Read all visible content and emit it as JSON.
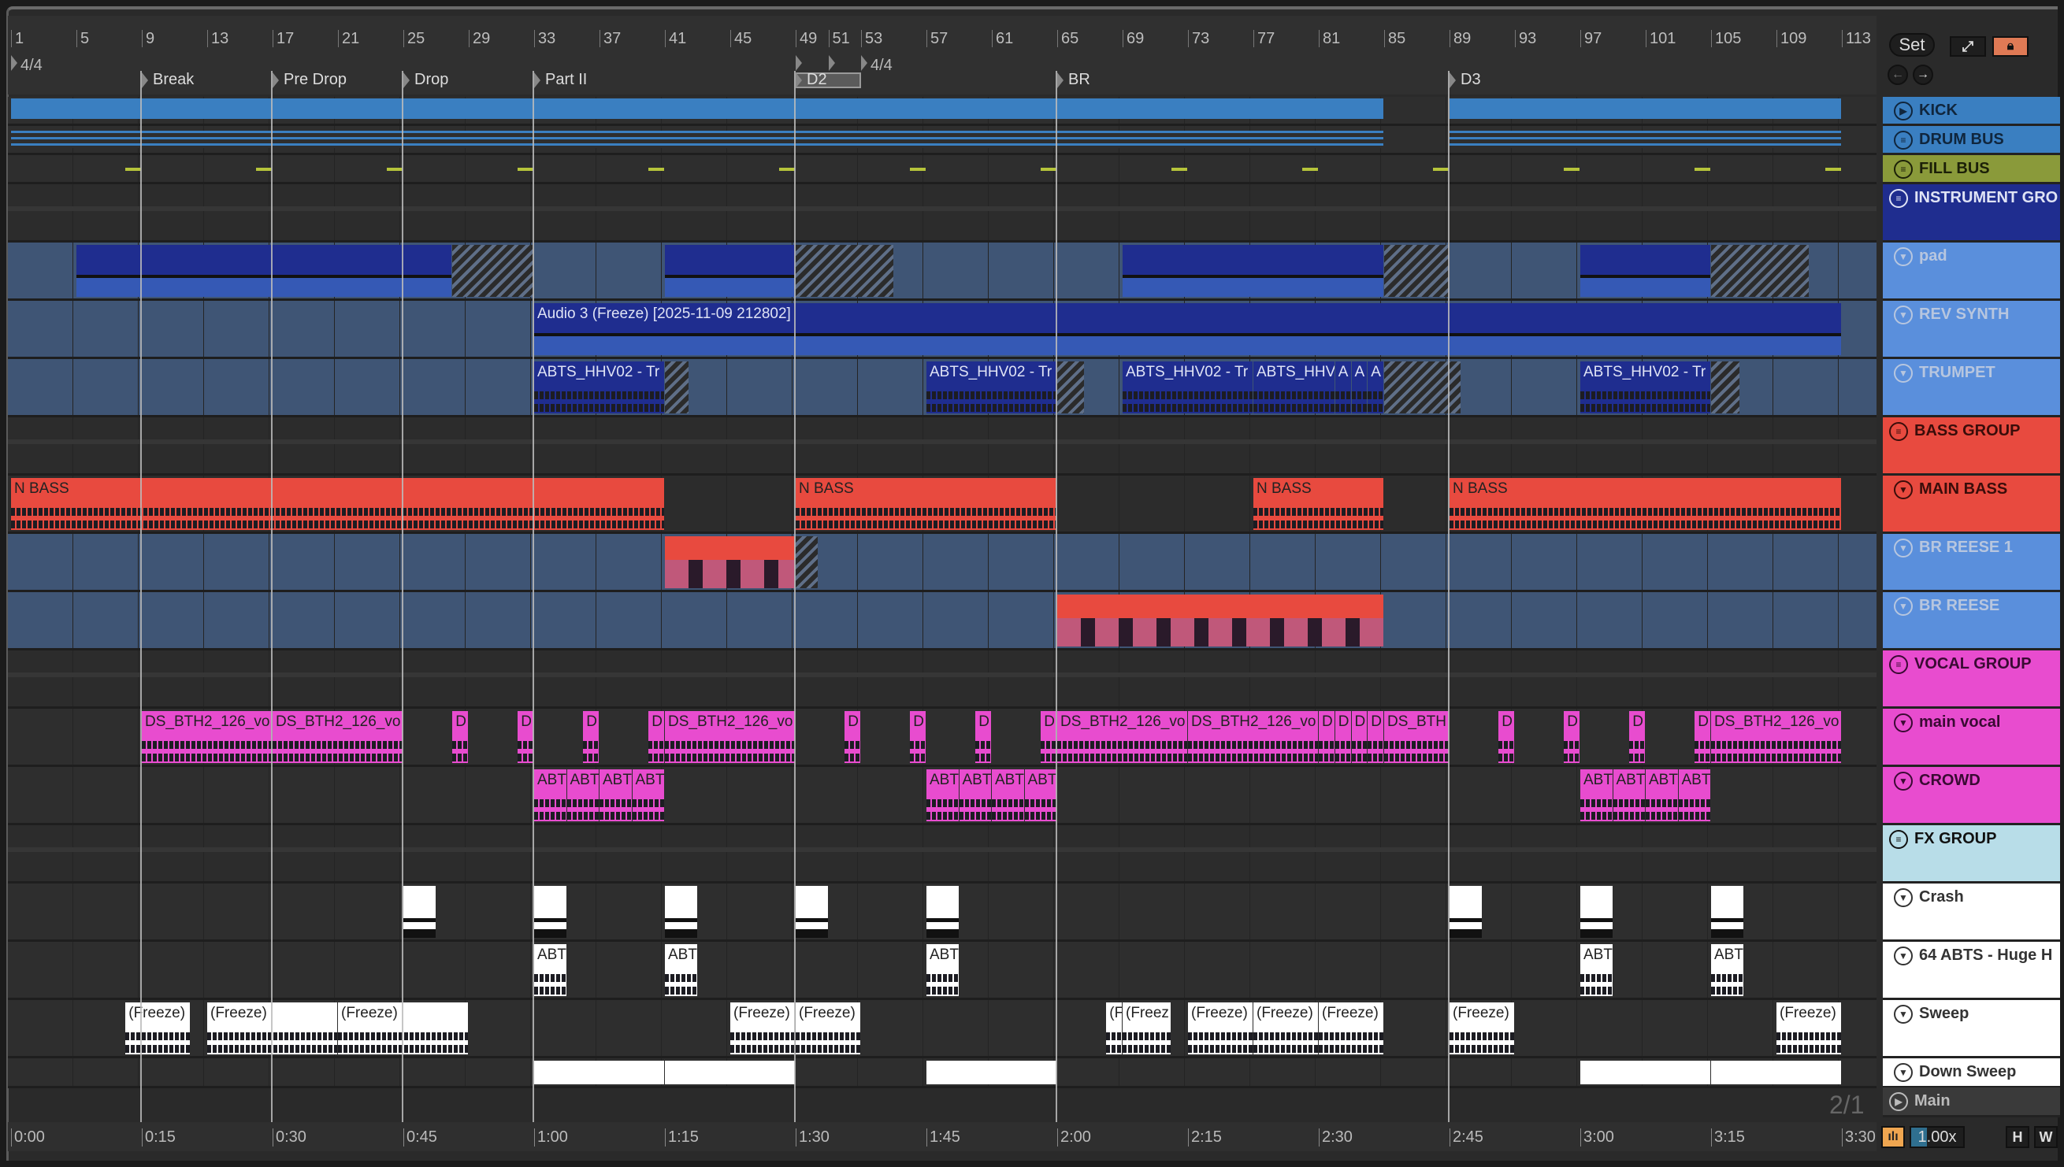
{
  "ruler": {
    "bars": [
      "1",
      "5",
      "9",
      "13",
      "17",
      "21",
      "25",
      "29",
      "33",
      "37",
      "41",
      "45",
      "49",
      "51",
      "53",
      "57",
      "61",
      "65",
      "69",
      "73",
      "77",
      "81",
      "85",
      "89",
      "93",
      "97",
      "101",
      "105",
      "109",
      "113"
    ],
    "bar_positions": [
      1,
      5,
      9,
      13,
      17,
      21,
      25,
      29,
      33,
      37,
      41,
      45,
      49,
      51,
      53,
      57,
      61,
      65,
      69,
      73,
      77,
      81,
      85,
      89,
      93,
      97,
      101,
      105,
      109,
      113
    ],
    "time_signatures": [
      {
        "bar": 1,
        "label": "4/4"
      },
      {
        "bar": 53,
        "label": "4/4"
      }
    ],
    "loop": {
      "start": 49,
      "end": 53
    },
    "locators": [
      {
        "bar": 9,
        "label": "Break"
      },
      {
        "bar": 17,
        "label": "Pre Drop"
      },
      {
        "bar": 25,
        "label": "Drop"
      },
      {
        "bar": 33,
        "label": "Part II"
      },
      {
        "bar": 49,
        "label": "D2"
      },
      {
        "bar": 65,
        "label": "BR"
      },
      {
        "bar": 89,
        "label": "D3"
      }
    ]
  },
  "time_ruler": [
    "0:00",
    "0:15",
    "0:30",
    "0:45",
    "1:00",
    "1:15",
    "1:30",
    "1:45",
    "2:00",
    "2:15",
    "2:30",
    "2:45",
    "3:00",
    "3:15",
    "3:30"
  ],
  "controls": {
    "set": "Set",
    "zoom": "1.00x",
    "h": "H",
    "w": "W",
    "grid": "2/1"
  },
  "colors": {
    "blue": "#3a7fc1",
    "olive": "#8a9a3a",
    "navy": "#1f2d8f",
    "lightblue": "#5a8fdc",
    "red": "#e84a3f",
    "pink": "#e84ccf",
    "cyan": "#b8dde8",
    "white": "#ffffff"
  },
  "tracks": [
    {
      "name": "KICK",
      "icon": "play",
      "color": "#3a7fc1",
      "text": "#10263d",
      "bg": "#2e2e2e",
      "clipColor": "#3a7fc1",
      "clips": [
        {
          "s": 1,
          "e": 85
        },
        {
          "s": 89,
          "e": 113
        }
      ]
    },
    {
      "name": "DRUM BUS",
      "icon": "group",
      "color": "#3a7fc1",
      "text": "#10263d",
      "bg": "#2e2e2e",
      "clipColor": "#3a7fc1",
      "thin": true,
      "clips": [
        {
          "s": 1,
          "e": 85
        },
        {
          "s": 89,
          "e": 113
        }
      ]
    },
    {
      "name": "FILL BUS",
      "icon": "group",
      "color": "#8a9a3a",
      "text": "#1c2008",
      "bg": "#2e2e2e",
      "clipColor": "#b6c43a",
      "dash": true,
      "clips": [
        {
          "s": 8,
          "e": 9
        },
        {
          "s": 16,
          "e": 17
        },
        {
          "s": 24,
          "e": 25
        },
        {
          "s": 32,
          "e": 33
        },
        {
          "s": 40,
          "e": 41
        },
        {
          "s": 48,
          "e": 49
        },
        {
          "s": 56,
          "e": 57
        },
        {
          "s": 64,
          "e": 65
        },
        {
          "s": 72,
          "e": 73
        },
        {
          "s": 80,
          "e": 81
        },
        {
          "s": 88,
          "e": 89
        },
        {
          "s": 96,
          "e": 97
        },
        {
          "s": 104,
          "e": 105
        },
        {
          "s": 112,
          "e": 113
        }
      ]
    },
    {
      "name": "INSTRUMENT GRO",
      "icon": "group",
      "color": "#1f2d8f",
      "text": "#dfe3f5",
      "bg": "#2c2c2c",
      "group": true,
      "clips": []
    },
    {
      "name": "pad",
      "icon": "fold",
      "color": "#5a8fdc",
      "text": "#b7c6df",
      "bg": "#3f5575",
      "clipColor": "#1f2d8f",
      "clips": [
        {
          "s": 5,
          "e": 28
        },
        {
          "s": 28,
          "e": 33,
          "hatch": true
        },
        {
          "s": 41,
          "e": 49
        },
        {
          "s": 49,
          "e": 55,
          "hatch": true
        },
        {
          "s": 69,
          "e": 85
        },
        {
          "s": 85,
          "e": 89,
          "hatch": true
        },
        {
          "s": 97,
          "e": 105
        },
        {
          "s": 105,
          "e": 111,
          "hatch": true
        }
      ]
    },
    {
      "name": "REV SYNTH",
      "icon": "fold",
      "color": "#5a8fdc",
      "text": "#b7c6df",
      "bg": "#3f5575",
      "clipColor": "#1f2d8f",
      "clips": [
        {
          "s": 33,
          "e": 113,
          "label": "Audio 3 (Freeze) [2025-11-09 212802]"
        }
      ]
    },
    {
      "name": "TRUMPET",
      "icon": "fold",
      "color": "#5a8fdc",
      "text": "#b7c6df",
      "bg": "#3f5575",
      "clipColor": "#1f2d8f",
      "wave": true,
      "clips": [
        {
          "s": 33,
          "e": 41,
          "label": "ABTS_HHV02 - Tr"
        },
        {
          "s": 41,
          "e": 42.5,
          "hatch": true
        },
        {
          "s": 57,
          "e": 65,
          "label": "ABTS_HHV02 - Tr"
        },
        {
          "s": 65,
          "e": 66.7,
          "hatch": true
        },
        {
          "s": 69,
          "e": 77,
          "label": "ABTS_HHV02 - Tr"
        },
        {
          "s": 77,
          "e": 82,
          "label": "ABTS_HHV"
        },
        {
          "s": 82,
          "e": 83,
          "label": "A"
        },
        {
          "s": 83,
          "e": 84,
          "label": "A"
        },
        {
          "s": 84,
          "e": 85,
          "label": "A"
        },
        {
          "s": 85,
          "e": 89.7,
          "hatch": true
        },
        {
          "s": 97,
          "e": 105,
          "label": "ABTS_HHV02 - Tr"
        },
        {
          "s": 105,
          "e": 106.8,
          "hatch": true
        }
      ]
    },
    {
      "name": "BASS GROUP",
      "icon": "group",
      "color": "#e84a3f",
      "text": "#3a0d0a",
      "bg": "#2c2c2c",
      "group": true,
      "clips": []
    },
    {
      "name": "MAIN BASS",
      "icon": "fold",
      "color": "#e84a3f",
      "text": "#3a0d0a",
      "bg": "#2c2c2c",
      "clipColor": "#e84a3f",
      "clips": [
        {
          "s": 1,
          "e": 41,
          "label": "N BASS"
        },
        {
          "s": 49,
          "e": 65,
          "label": "N BASS"
        },
        {
          "s": 77,
          "e": 85,
          "label": "N BASS"
        },
        {
          "s": 89,
          "e": 113,
          "label": "N BASS"
        }
      ]
    },
    {
      "name": "BR REESE 1",
      "icon": "fold",
      "color": "#5a8fdc",
      "text": "#b7c6df",
      "bg": "#3f5575",
      "clipColor": "#e84a3f",
      "clips": [
        {
          "s": 41,
          "e": 49
        },
        {
          "s": 49,
          "e": 50.4,
          "hatch": true
        }
      ]
    },
    {
      "name": "BR REESE",
      "icon": "fold",
      "color": "#5a8fdc",
      "text": "#b7c6df",
      "bg": "#3f5575",
      "clipColor": "#e84a3f",
      "clips": [
        {
          "s": 65,
          "e": 85
        }
      ]
    },
    {
      "name": "VOCAL GROUP",
      "icon": "group",
      "color": "#e84ccf",
      "text": "#3a0a33",
      "bg": "#2c2c2c",
      "group": true,
      "clips": []
    },
    {
      "name": "main vocal",
      "icon": "fold",
      "color": "#e84ccf",
      "text": "#3a0a33",
      "bg": "#2e2e2e",
      "clipColor": "#e84ccf",
      "wave": true,
      "clips": [
        {
          "s": 9,
          "e": 17,
          "label": "DS_BTH2_126_vo"
        },
        {
          "s": 17,
          "e": 25,
          "label": "DS_BTH2_126_vo"
        },
        {
          "s": 28,
          "e": 29,
          "label": "D"
        },
        {
          "s": 32,
          "e": 33,
          "label": "D"
        },
        {
          "s": 36,
          "e": 37,
          "label": "D"
        },
        {
          "s": 40,
          "e": 41,
          "label": "D"
        },
        {
          "s": 41,
          "e": 49,
          "label": "DS_BTH2_126_vo"
        },
        {
          "s": 52,
          "e": 53,
          "label": "D"
        },
        {
          "s": 56,
          "e": 57,
          "label": "D"
        },
        {
          "s": 60,
          "e": 61,
          "label": "D"
        },
        {
          "s": 64,
          "e": 65,
          "label": "D"
        },
        {
          "s": 65,
          "e": 73,
          "label": "DS_BTH2_126_vo"
        },
        {
          "s": 73,
          "e": 81,
          "label": "DS_BTH2_126_vo"
        },
        {
          "s": 81,
          "e": 82,
          "label": "D"
        },
        {
          "s": 82,
          "e": 83,
          "label": "D"
        },
        {
          "s": 83,
          "e": 84,
          "label": "D"
        },
        {
          "s": 84,
          "e": 85,
          "label": "D"
        },
        {
          "s": 85,
          "e": 89,
          "label": "DS_BTH"
        },
        {
          "s": 92,
          "e": 93,
          "label": "D"
        },
        {
          "s": 96,
          "e": 97,
          "label": "D"
        },
        {
          "s": 100,
          "e": 101,
          "label": "D"
        },
        {
          "s": 104,
          "e": 105,
          "label": "D"
        },
        {
          "s": 105,
          "e": 113,
          "label": "DS_BTH2_126_vo"
        }
      ]
    },
    {
      "name": "CROWD",
      "icon": "fold",
      "color": "#e84ccf",
      "text": "#3a0a33",
      "bg": "#2e2e2e",
      "clipColor": "#e84ccf",
      "wave": true,
      "clips": [
        {
          "s": 33,
          "e": 35,
          "label": "ABT"
        },
        {
          "s": 35,
          "e": 37,
          "label": "ABT"
        },
        {
          "s": 37,
          "e": 39,
          "label": "ABT"
        },
        {
          "s": 39,
          "e": 41,
          "label": "ABT"
        },
        {
          "s": 57,
          "e": 59,
          "label": "ABT"
        },
        {
          "s": 59,
          "e": 61,
          "label": "ABT"
        },
        {
          "s": 61,
          "e": 63,
          "label": "ABT"
        },
        {
          "s": 63,
          "e": 65,
          "label": "ABT"
        },
        {
          "s": 97,
          "e": 99,
          "label": "ABT"
        },
        {
          "s": 99,
          "e": 101,
          "label": "ABT"
        },
        {
          "s": 101,
          "e": 103,
          "label": "ABT"
        },
        {
          "s": 103,
          "e": 105,
          "label": "ABT"
        }
      ]
    },
    {
      "name": "FX GROUP",
      "icon": "group",
      "color": "#b8dde8",
      "text": "#111",
      "bg": "#2c2c2c",
      "group": true,
      "clips": []
    },
    {
      "name": "Crash",
      "icon": "fold",
      "color": "#ffffff",
      "text": "#333",
      "bg": "#2e2e2e",
      "clipColor": "#ffffff",
      "clips": [
        {
          "s": 25,
          "e": 27
        },
        {
          "s": 33,
          "e": 35
        },
        {
          "s": 41,
          "e": 43
        },
        {
          "s": 49,
          "e": 51
        },
        {
          "s": 57,
          "e": 59
        },
        {
          "s": 89,
          "e": 91
        },
        {
          "s": 97,
          "e": 99
        },
        {
          "s": 105,
          "e": 107
        }
      ]
    },
    {
      "name": "64 ABTS - Huge H",
      "icon": "fold",
      "color": "#ffffff",
      "text": "#333",
      "bg": "#2e2e2e",
      "clipColor": "#ffffff",
      "wave": true,
      "clips": [
        {
          "s": 33,
          "e": 35,
          "label": "ABT"
        },
        {
          "s": 41,
          "e": 43,
          "label": "ABT"
        },
        {
          "s": 57,
          "e": 59,
          "label": "ABT"
        },
        {
          "s": 97,
          "e": 99,
          "label": "ABT"
        },
        {
          "s": 105,
          "e": 107,
          "label": "ABT"
        }
      ]
    },
    {
      "name": "Sweep",
      "icon": "fold",
      "color": "#ffffff",
      "text": "#333",
      "bg": "#2e2e2e",
      "clipColor": "#ffffff",
      "wave": true,
      "clips": [
        {
          "s": 8,
          "e": 12,
          "label": "(Freeze)"
        },
        {
          "s": 13,
          "e": 21,
          "label": "(Freeze)"
        },
        {
          "s": 21,
          "e": 29,
          "label": "(Freeze)"
        },
        {
          "s": 45,
          "e": 49,
          "label": "(Freeze)"
        },
        {
          "s": 49,
          "e": 53,
          "label": "(Freeze)"
        },
        {
          "s": 68,
          "e": 69,
          "label": "(F"
        },
        {
          "s": 69,
          "e": 72,
          "label": "(Freez"
        },
        {
          "s": 73,
          "e": 77,
          "label": "(Freeze)"
        },
        {
          "s": 77,
          "e": 81,
          "label": "(Freeze)"
        },
        {
          "s": 81,
          "e": 85,
          "label": "(Freeze)"
        },
        {
          "s": 89,
          "e": 93,
          "label": "(Freeze)"
        },
        {
          "s": 109,
          "e": 113,
          "label": "(Freeze)"
        }
      ]
    },
    {
      "name": "Down Sweep",
      "icon": "fold",
      "color": "#ffffff",
      "text": "#333",
      "bg": "#2e2e2e",
      "clipColor": "#ffffff",
      "clips": [
        {
          "s": 33,
          "e": 41
        },
        {
          "s": 41,
          "e": 49
        },
        {
          "s": 57,
          "e": 65
        },
        {
          "s": 97,
          "e": 105
        },
        {
          "s": 105,
          "e": 113
        }
      ]
    },
    {
      "name": "Main",
      "icon": "play",
      "color": "#3a3a3a",
      "text": "#bbb",
      "bg": "#2e2e2e",
      "clips": []
    }
  ]
}
